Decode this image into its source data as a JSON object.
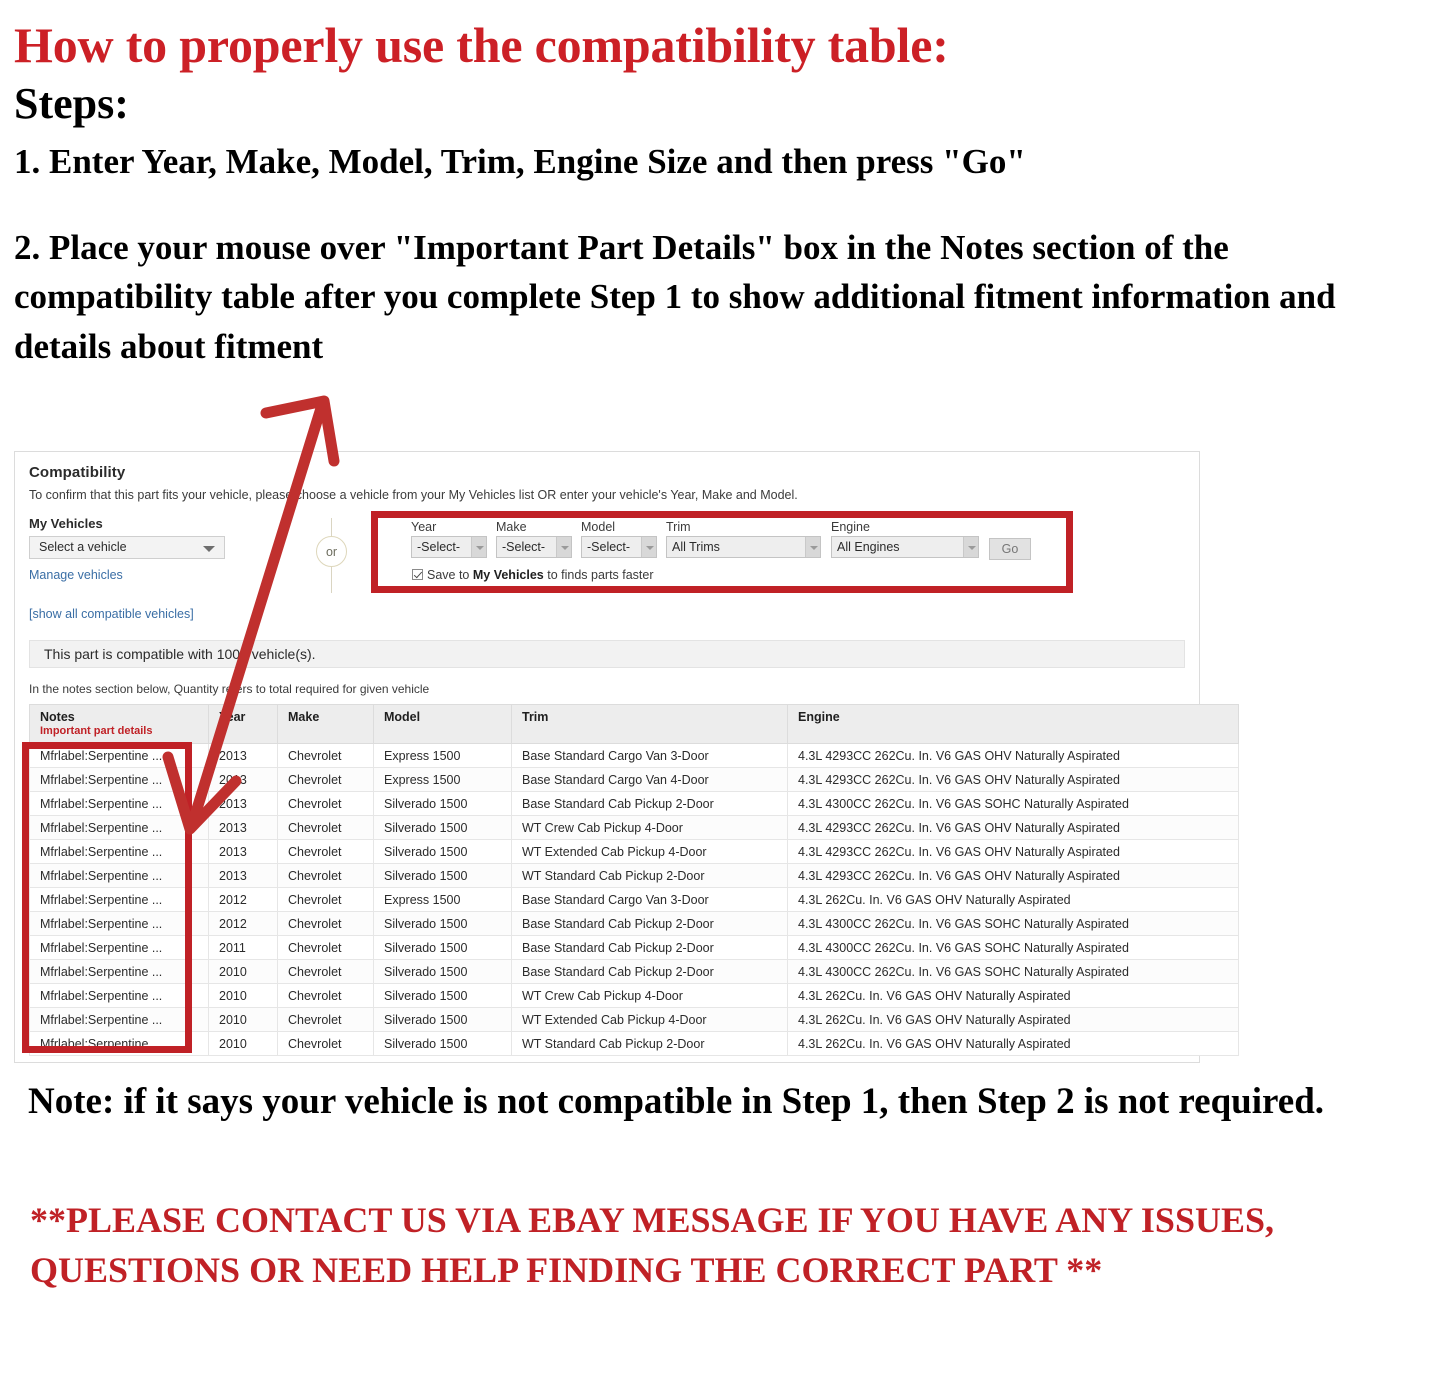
{
  "instructions": {
    "heading": "How to properly use the compatibility table:",
    "steps_label": "Steps:",
    "step1": "1. Enter Year, Make, Model, Trim, Engine Size and then press \"Go\"",
    "step2": "2. Place your mouse over \"Important Part Details\" box in the Notes section of the compatibility table after you complete Step 1 to show additional fitment information and details about fitment",
    "note": "Note: if it says your vehicle is not compatible in Step 1, then Step 2 is not required.",
    "contact": "**PLEASE CONTACT US VIA EBAY MESSAGE IF YOU HAVE ANY ISSUES, QUESTIONS OR NEED HELP FINDING THE CORRECT PART **"
  },
  "colors": {
    "accent_red": "#cc2026",
    "highlight_box_red": "#c02126",
    "link_blue": "#3a6ea5",
    "arrow_red": "#c0302e"
  },
  "compatibility": {
    "title": "Compatibility",
    "subtitle": "To confirm that this part fits your vehicle, please choose a vehicle from your My Vehicles list OR enter your vehicle's Year, Make and Model.",
    "my_vehicles": {
      "label": "My Vehicles",
      "select_value": "Select a vehicle",
      "manage_link": "Manage vehicles",
      "show_all_link": "[show all compatible vehicles]"
    },
    "or_divider": "or",
    "finder": {
      "fields": [
        {
          "label": "Year",
          "value": "-Select-"
        },
        {
          "label": "Make",
          "value": "-Select-"
        },
        {
          "label": "Model",
          "value": "-Select-"
        },
        {
          "label": "Trim",
          "value": "All Trims"
        },
        {
          "label": "Engine",
          "value": "All Engines"
        }
      ],
      "go_label": "Go",
      "save_checkbox": {
        "checked": true,
        "text_before": "Save to ",
        "text_bold": "My Vehicles",
        "text_after": " to finds parts faster"
      }
    },
    "compatible_banner": "This part is compatible with 1000 vehicle(s).",
    "notes_hint": "In the notes section below, Quantity refers to total required for given vehicle",
    "table": {
      "headers": {
        "notes": "Notes",
        "notes_sub": "Important part details",
        "year": "Year",
        "make": "Make",
        "model": "Model",
        "trim": "Trim",
        "engine": "Engine"
      },
      "rows": [
        {
          "notes": "Mfrlabel:Serpentine ...",
          "year": "2013",
          "make": "Chevrolet",
          "model": "Express 1500",
          "trim": "Base Standard Cargo Van 3-Door",
          "engine": "4.3L 4293CC 262Cu. In. V6 GAS OHV Naturally Aspirated"
        },
        {
          "notes": "Mfrlabel:Serpentine ...",
          "year": "2013",
          "make": "Chevrolet",
          "model": "Express 1500",
          "trim": "Base Standard Cargo Van 4-Door",
          "engine": "4.3L 4293CC 262Cu. In. V6 GAS OHV Naturally Aspirated"
        },
        {
          "notes": "Mfrlabel:Serpentine ...",
          "year": "2013",
          "make": "Chevrolet",
          "model": "Silverado 1500",
          "trim": "Base Standard Cab Pickup 2-Door",
          "engine": "4.3L 4300CC 262Cu. In. V6 GAS SOHC Naturally Aspirated"
        },
        {
          "notes": "Mfrlabel:Serpentine ...",
          "year": "2013",
          "make": "Chevrolet",
          "model": "Silverado 1500",
          "trim": "WT Crew Cab Pickup 4-Door",
          "engine": "4.3L 4293CC 262Cu. In. V6 GAS OHV Naturally Aspirated"
        },
        {
          "notes": "Mfrlabel:Serpentine ...",
          "year": "2013",
          "make": "Chevrolet",
          "model": "Silverado 1500",
          "trim": "WT Extended Cab Pickup 4-Door",
          "engine": "4.3L 4293CC 262Cu. In. V6 GAS OHV Naturally Aspirated"
        },
        {
          "notes": "Mfrlabel:Serpentine ...",
          "year": "2013",
          "make": "Chevrolet",
          "model": "Silverado 1500",
          "trim": "WT Standard Cab Pickup 2-Door",
          "engine": "4.3L 4293CC 262Cu. In. V6 GAS OHV Naturally Aspirated"
        },
        {
          "notes": "Mfrlabel:Serpentine ...",
          "year": "2012",
          "make": "Chevrolet",
          "model": "Express 1500",
          "trim": "Base Standard Cargo Van 3-Door",
          "engine": "4.3L 262Cu. In. V6 GAS OHV Naturally Aspirated"
        },
        {
          "notes": "Mfrlabel:Serpentine ...",
          "year": "2012",
          "make": "Chevrolet",
          "model": "Silverado 1500",
          "trim": "Base Standard Cab Pickup 2-Door",
          "engine": "4.3L 4300CC 262Cu. In. V6 GAS SOHC Naturally Aspirated"
        },
        {
          "notes": "Mfrlabel:Serpentine ...",
          "year": "2011",
          "make": "Chevrolet",
          "model": "Silverado 1500",
          "trim": "Base Standard Cab Pickup 2-Door",
          "engine": "4.3L 4300CC 262Cu. In. V6 GAS SOHC Naturally Aspirated"
        },
        {
          "notes": "Mfrlabel:Serpentine ...",
          "year": "2010",
          "make": "Chevrolet",
          "model": "Silverado 1500",
          "trim": "Base Standard Cab Pickup 2-Door",
          "engine": "4.3L 4300CC 262Cu. In. V6 GAS SOHC Naturally Aspirated"
        },
        {
          "notes": "Mfrlabel:Serpentine ...",
          "year": "2010",
          "make": "Chevrolet",
          "model": "Silverado 1500",
          "trim": "WT Crew Cab Pickup 4-Door",
          "engine": "4.3L 262Cu. In. V6 GAS OHV Naturally Aspirated"
        },
        {
          "notes": "Mfrlabel:Serpentine ...",
          "year": "2010",
          "make": "Chevrolet",
          "model": "Silverado 1500",
          "trim": "WT Extended Cab Pickup 4-Door",
          "engine": "4.3L 262Cu. In. V6 GAS OHV Naturally Aspirated"
        },
        {
          "notes": "Mfrlabel:Serpentine ...",
          "year": "2010",
          "make": "Chevrolet",
          "model": "Silverado 1500",
          "trim": "WT Standard Cab Pickup 2-Door",
          "engine": "4.3L 262Cu. In. V6 GAS OHV Naturally Aspirated"
        }
      ]
    }
  }
}
